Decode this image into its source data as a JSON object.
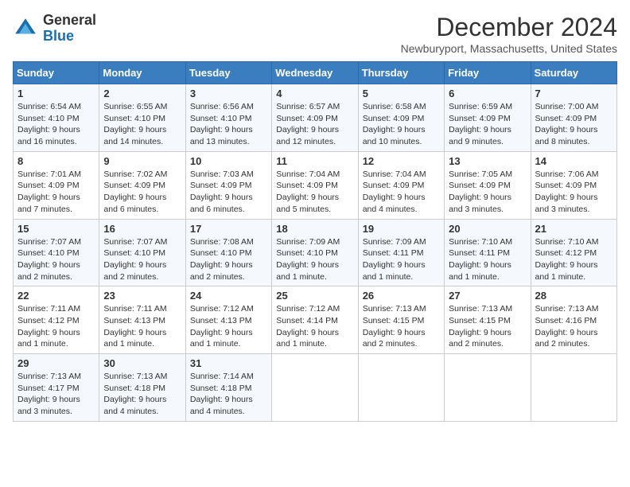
{
  "logo": {
    "general": "General",
    "blue": "Blue"
  },
  "title": "December 2024",
  "location": "Newburyport, Massachusetts, United States",
  "days_of_week": [
    "Sunday",
    "Monday",
    "Tuesday",
    "Wednesday",
    "Thursday",
    "Friday",
    "Saturday"
  ],
  "weeks": [
    [
      {
        "day": "1",
        "info": "Sunrise: 6:54 AM\nSunset: 4:10 PM\nDaylight: 9 hours\nand 16 minutes."
      },
      {
        "day": "2",
        "info": "Sunrise: 6:55 AM\nSunset: 4:10 PM\nDaylight: 9 hours\nand 14 minutes."
      },
      {
        "day": "3",
        "info": "Sunrise: 6:56 AM\nSunset: 4:10 PM\nDaylight: 9 hours\nand 13 minutes."
      },
      {
        "day": "4",
        "info": "Sunrise: 6:57 AM\nSunset: 4:09 PM\nDaylight: 9 hours\nand 12 minutes."
      },
      {
        "day": "5",
        "info": "Sunrise: 6:58 AM\nSunset: 4:09 PM\nDaylight: 9 hours\nand 10 minutes."
      },
      {
        "day": "6",
        "info": "Sunrise: 6:59 AM\nSunset: 4:09 PM\nDaylight: 9 hours\nand 9 minutes."
      },
      {
        "day": "7",
        "info": "Sunrise: 7:00 AM\nSunset: 4:09 PM\nDaylight: 9 hours\nand 8 minutes."
      }
    ],
    [
      {
        "day": "8",
        "info": "Sunrise: 7:01 AM\nSunset: 4:09 PM\nDaylight: 9 hours\nand 7 minutes."
      },
      {
        "day": "9",
        "info": "Sunrise: 7:02 AM\nSunset: 4:09 PM\nDaylight: 9 hours\nand 6 minutes."
      },
      {
        "day": "10",
        "info": "Sunrise: 7:03 AM\nSunset: 4:09 PM\nDaylight: 9 hours\nand 6 minutes."
      },
      {
        "day": "11",
        "info": "Sunrise: 7:04 AM\nSunset: 4:09 PM\nDaylight: 9 hours\nand 5 minutes."
      },
      {
        "day": "12",
        "info": "Sunrise: 7:04 AM\nSunset: 4:09 PM\nDaylight: 9 hours\nand 4 minutes."
      },
      {
        "day": "13",
        "info": "Sunrise: 7:05 AM\nSunset: 4:09 PM\nDaylight: 9 hours\nand 3 minutes."
      },
      {
        "day": "14",
        "info": "Sunrise: 7:06 AM\nSunset: 4:09 PM\nDaylight: 9 hours\nand 3 minutes."
      }
    ],
    [
      {
        "day": "15",
        "info": "Sunrise: 7:07 AM\nSunset: 4:10 PM\nDaylight: 9 hours\nand 2 minutes."
      },
      {
        "day": "16",
        "info": "Sunrise: 7:07 AM\nSunset: 4:10 PM\nDaylight: 9 hours\nand 2 minutes."
      },
      {
        "day": "17",
        "info": "Sunrise: 7:08 AM\nSunset: 4:10 PM\nDaylight: 9 hours\nand 2 minutes."
      },
      {
        "day": "18",
        "info": "Sunrise: 7:09 AM\nSunset: 4:10 PM\nDaylight: 9 hours\nand 1 minute."
      },
      {
        "day": "19",
        "info": "Sunrise: 7:09 AM\nSunset: 4:11 PM\nDaylight: 9 hours\nand 1 minute."
      },
      {
        "day": "20",
        "info": "Sunrise: 7:10 AM\nSunset: 4:11 PM\nDaylight: 9 hours\nand 1 minute."
      },
      {
        "day": "21",
        "info": "Sunrise: 7:10 AM\nSunset: 4:12 PM\nDaylight: 9 hours\nand 1 minute."
      }
    ],
    [
      {
        "day": "22",
        "info": "Sunrise: 7:11 AM\nSunset: 4:12 PM\nDaylight: 9 hours\nand 1 minute."
      },
      {
        "day": "23",
        "info": "Sunrise: 7:11 AM\nSunset: 4:13 PM\nDaylight: 9 hours\nand 1 minute."
      },
      {
        "day": "24",
        "info": "Sunrise: 7:12 AM\nSunset: 4:13 PM\nDaylight: 9 hours\nand 1 minute."
      },
      {
        "day": "25",
        "info": "Sunrise: 7:12 AM\nSunset: 4:14 PM\nDaylight: 9 hours\nand 1 minute."
      },
      {
        "day": "26",
        "info": "Sunrise: 7:13 AM\nSunset: 4:15 PM\nDaylight: 9 hours\nand 2 minutes."
      },
      {
        "day": "27",
        "info": "Sunrise: 7:13 AM\nSunset: 4:15 PM\nDaylight: 9 hours\nand 2 minutes."
      },
      {
        "day": "28",
        "info": "Sunrise: 7:13 AM\nSunset: 4:16 PM\nDaylight: 9 hours\nand 2 minutes."
      }
    ],
    [
      {
        "day": "29",
        "info": "Sunrise: 7:13 AM\nSunset: 4:17 PM\nDaylight: 9 hours\nand 3 minutes."
      },
      {
        "day": "30",
        "info": "Sunrise: 7:13 AM\nSunset: 4:18 PM\nDaylight: 9 hours\nand 4 minutes."
      },
      {
        "day": "31",
        "info": "Sunrise: 7:14 AM\nSunset: 4:18 PM\nDaylight: 9 hours\nand 4 minutes."
      },
      {
        "day": "",
        "info": ""
      },
      {
        "day": "",
        "info": ""
      },
      {
        "day": "",
        "info": ""
      },
      {
        "day": "",
        "info": ""
      }
    ]
  ]
}
